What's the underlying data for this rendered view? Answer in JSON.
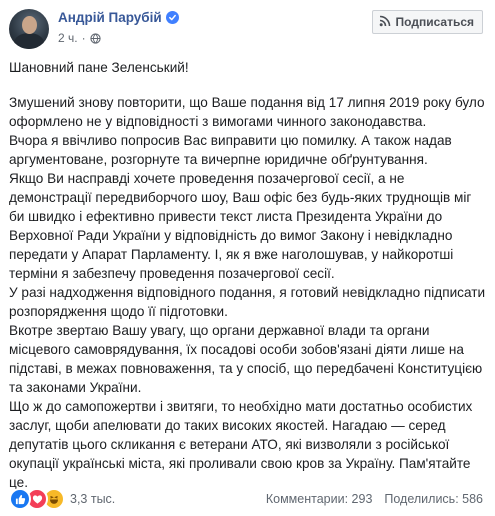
{
  "author": {
    "name": "Андрій Парубій",
    "time": "2 ч."
  },
  "follow_button": {
    "label": "Подписаться"
  },
  "post": {
    "greeting": "Шановний пане Зеленський!",
    "paragraphs": [
      "Змушений знову повторити, що Ваше подання від 17 липня 2019 року було оформлено не у відповідності з вимогами чинного законодавства.",
      "Вчора я ввічливо попросив Вас виправити цю помилку. А також надав аргументоване, розгорнуте та вичерпне юридичне обґрунтування.",
      "Якщо Ви насправді хочете проведення позачергової сесії, а не демонстрації передвиборчого шоу, Ваш офіс без будь-яких труднощів міг би швидко і ефективно привести текст листа Президента України до Верховної Ради України у відповідність до вимог Закону і невідкладно передати у Апарат Парламенту. І, як я вже наголошував, у найкоротші терміни я забезпечу проведення позачергової сесії.",
      "У разі надходження відповідного подання, я готовий невідкладно підписати розпорядження щодо її підготовки.",
      "Вкотре звертаю Вашу увагу, що органи державної влади та органи місцевого самоврядування, їх посадові особи зобов'язані діяти лише на підставі, в межах повноваження, та у спосіб, що передбачені Конституцією та законами України.",
      "Що ж до самопожертви і звитяги, то необхідно мати достатньо особистих заслуг, щоби апелювати до таких високих якостей. Нагадаю — серед депутатів цього скликання є ветерани АТО, які визволяли з російської окупації українські міста, які проливали свою кров за Україну. Пам'ятайте це."
    ]
  },
  "footer": {
    "reaction_count": "3,3 тыс.",
    "comments": "Комментарии: 293",
    "shares": "Поделились: 586"
  },
  "icons": {
    "verified": "verified-badge-icon",
    "audience": "globe-icon",
    "follow": "rss-follow-icon",
    "reactions": [
      "like-icon",
      "love-icon",
      "haha-icon"
    ]
  },
  "colors": {
    "link": "#385898",
    "like": "#1877f2",
    "love": "#f33e58",
    "haha": "#f7b928"
  }
}
